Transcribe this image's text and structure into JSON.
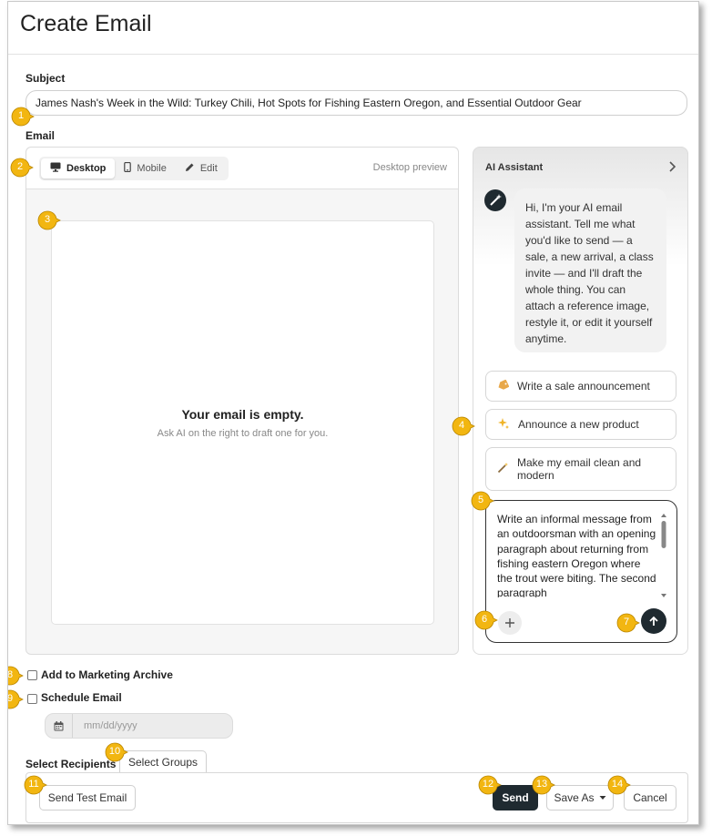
{
  "page": {
    "title": "Create Email"
  },
  "subject": {
    "label": "Subject",
    "value": "James Nash's Week in the Wild: Turkey Chili, Hot Spots for Fishing Eastern Oregon, and Essential Outdoor Gear"
  },
  "email": {
    "label": "Email",
    "view_tabs": [
      {
        "label": "Desktop",
        "icon": "monitor-icon",
        "active": true
      },
      {
        "label": "Mobile",
        "icon": "phone-icon",
        "active": false
      },
      {
        "label": "Edit",
        "icon": "pencil-icon",
        "active": false
      }
    ],
    "preview_label": "Desktop preview",
    "empty_title": "Your email is empty.",
    "empty_subtitle": "Ask AI on the right to draft one for you."
  },
  "ai_assistant": {
    "title": "AI Assistant",
    "greeting": "Hi, I'm your AI email assistant. Tell me what you'd like to send — a sale, a new arrival, a class invite — and I'll draft the whole thing. You can attach a reference image, restyle it, or edit it yourself anytime.",
    "suggestions": [
      {
        "label": "Write a sale announcement",
        "icon": "tag-icon"
      },
      {
        "label": "Announce a new product",
        "icon": "sparkle-icon"
      },
      {
        "label": "Make my email clean and modern",
        "icon": "magic-wand-icon"
      }
    ],
    "prompt_value": "Write an informal message from an outdoorsman with an opening paragraph about returning from fishing eastern Oregon where the trout were biting. The second paragraph"
  },
  "options": {
    "archive_label": "Add to Marketing Archive",
    "schedule_label": "Schedule Email",
    "date_placeholder": "mm/dd/yyyy"
  },
  "recipients": {
    "label": "Select Recipients",
    "tab_label": "Select Groups"
  },
  "actions": {
    "test_label": "Send Test Email",
    "send_label": "Send",
    "save_as_label": "Save As",
    "cancel_label": "Cancel"
  },
  "callouts": [
    "1",
    "2",
    "3",
    "4",
    "5",
    "6",
    "7",
    "8",
    "9",
    "10",
    "11",
    "12",
    "13",
    "14"
  ],
  "colors": {
    "callout": "#f2b611",
    "dark_button": "#1f2a30"
  }
}
